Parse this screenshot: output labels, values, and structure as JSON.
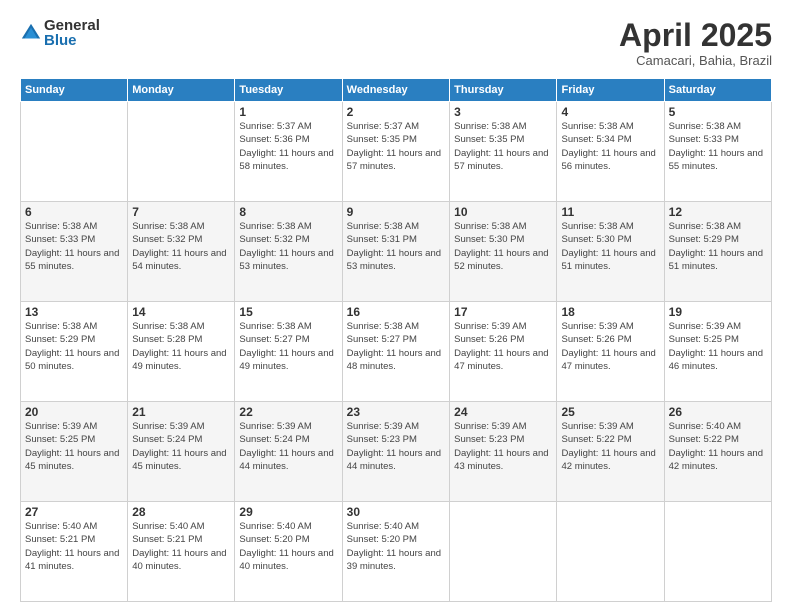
{
  "logo": {
    "general": "General",
    "blue": "Blue"
  },
  "title": "April 2025",
  "subtitle": "Camacari, Bahia, Brazil",
  "headers": [
    "Sunday",
    "Monday",
    "Tuesday",
    "Wednesday",
    "Thursday",
    "Friday",
    "Saturday"
  ],
  "weeks": [
    [
      {
        "day": "",
        "info": ""
      },
      {
        "day": "",
        "info": ""
      },
      {
        "day": "1",
        "info": "Sunrise: 5:37 AM\nSunset: 5:36 PM\nDaylight: 11 hours and 58 minutes."
      },
      {
        "day": "2",
        "info": "Sunrise: 5:37 AM\nSunset: 5:35 PM\nDaylight: 11 hours and 57 minutes."
      },
      {
        "day": "3",
        "info": "Sunrise: 5:38 AM\nSunset: 5:35 PM\nDaylight: 11 hours and 57 minutes."
      },
      {
        "day": "4",
        "info": "Sunrise: 5:38 AM\nSunset: 5:34 PM\nDaylight: 11 hours and 56 minutes."
      },
      {
        "day": "5",
        "info": "Sunrise: 5:38 AM\nSunset: 5:33 PM\nDaylight: 11 hours and 55 minutes."
      }
    ],
    [
      {
        "day": "6",
        "info": "Sunrise: 5:38 AM\nSunset: 5:33 PM\nDaylight: 11 hours and 55 minutes."
      },
      {
        "day": "7",
        "info": "Sunrise: 5:38 AM\nSunset: 5:32 PM\nDaylight: 11 hours and 54 minutes."
      },
      {
        "day": "8",
        "info": "Sunrise: 5:38 AM\nSunset: 5:32 PM\nDaylight: 11 hours and 53 minutes."
      },
      {
        "day": "9",
        "info": "Sunrise: 5:38 AM\nSunset: 5:31 PM\nDaylight: 11 hours and 53 minutes."
      },
      {
        "day": "10",
        "info": "Sunrise: 5:38 AM\nSunset: 5:30 PM\nDaylight: 11 hours and 52 minutes."
      },
      {
        "day": "11",
        "info": "Sunrise: 5:38 AM\nSunset: 5:30 PM\nDaylight: 11 hours and 51 minutes."
      },
      {
        "day": "12",
        "info": "Sunrise: 5:38 AM\nSunset: 5:29 PM\nDaylight: 11 hours and 51 minutes."
      }
    ],
    [
      {
        "day": "13",
        "info": "Sunrise: 5:38 AM\nSunset: 5:29 PM\nDaylight: 11 hours and 50 minutes."
      },
      {
        "day": "14",
        "info": "Sunrise: 5:38 AM\nSunset: 5:28 PM\nDaylight: 11 hours and 49 minutes."
      },
      {
        "day": "15",
        "info": "Sunrise: 5:38 AM\nSunset: 5:27 PM\nDaylight: 11 hours and 49 minutes."
      },
      {
        "day": "16",
        "info": "Sunrise: 5:38 AM\nSunset: 5:27 PM\nDaylight: 11 hours and 48 minutes."
      },
      {
        "day": "17",
        "info": "Sunrise: 5:39 AM\nSunset: 5:26 PM\nDaylight: 11 hours and 47 minutes."
      },
      {
        "day": "18",
        "info": "Sunrise: 5:39 AM\nSunset: 5:26 PM\nDaylight: 11 hours and 47 minutes."
      },
      {
        "day": "19",
        "info": "Sunrise: 5:39 AM\nSunset: 5:25 PM\nDaylight: 11 hours and 46 minutes."
      }
    ],
    [
      {
        "day": "20",
        "info": "Sunrise: 5:39 AM\nSunset: 5:25 PM\nDaylight: 11 hours and 45 minutes."
      },
      {
        "day": "21",
        "info": "Sunrise: 5:39 AM\nSunset: 5:24 PM\nDaylight: 11 hours and 45 minutes."
      },
      {
        "day": "22",
        "info": "Sunrise: 5:39 AM\nSunset: 5:24 PM\nDaylight: 11 hours and 44 minutes."
      },
      {
        "day": "23",
        "info": "Sunrise: 5:39 AM\nSunset: 5:23 PM\nDaylight: 11 hours and 44 minutes."
      },
      {
        "day": "24",
        "info": "Sunrise: 5:39 AM\nSunset: 5:23 PM\nDaylight: 11 hours and 43 minutes."
      },
      {
        "day": "25",
        "info": "Sunrise: 5:39 AM\nSunset: 5:22 PM\nDaylight: 11 hours and 42 minutes."
      },
      {
        "day": "26",
        "info": "Sunrise: 5:40 AM\nSunset: 5:22 PM\nDaylight: 11 hours and 42 minutes."
      }
    ],
    [
      {
        "day": "27",
        "info": "Sunrise: 5:40 AM\nSunset: 5:21 PM\nDaylight: 11 hours and 41 minutes."
      },
      {
        "day": "28",
        "info": "Sunrise: 5:40 AM\nSunset: 5:21 PM\nDaylight: 11 hours and 40 minutes."
      },
      {
        "day": "29",
        "info": "Sunrise: 5:40 AM\nSunset: 5:20 PM\nDaylight: 11 hours and 40 minutes."
      },
      {
        "day": "30",
        "info": "Sunrise: 5:40 AM\nSunset: 5:20 PM\nDaylight: 11 hours and 39 minutes."
      },
      {
        "day": "",
        "info": ""
      },
      {
        "day": "",
        "info": ""
      },
      {
        "day": "",
        "info": ""
      }
    ]
  ]
}
